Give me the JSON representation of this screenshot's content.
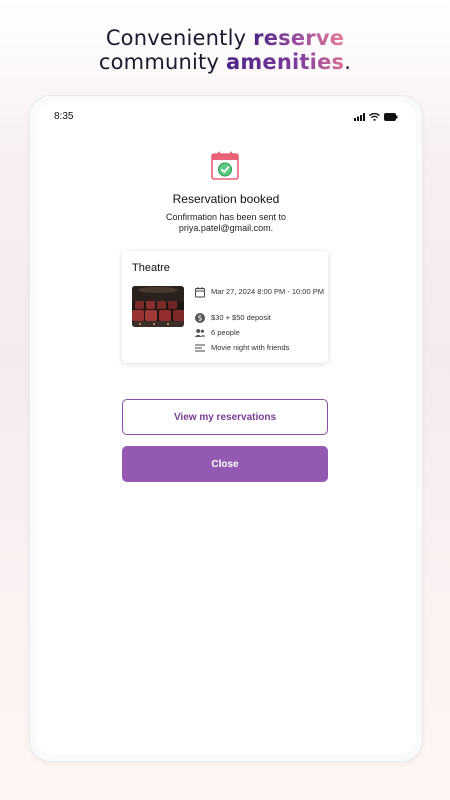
{
  "headline": {
    "line1_prefix": "Conveniently ",
    "line1_highlight": "reserve",
    "line2_prefix": "community ",
    "line2_highlight": "amenities",
    "line2_suffix": "."
  },
  "status_bar": {
    "time": "8:35"
  },
  "confirmation": {
    "title": "Reservation booked",
    "message_line1": "Confirmation has been sent to",
    "message_line2": "priya.patel@gmail.com."
  },
  "reservation": {
    "amenity": "Theatre",
    "datetime": "Mar 27, 2024 8:00 PM - 10:00 PM",
    "cost": "$30 + $50 deposit",
    "guests": "6 people",
    "note": "Movie night with friends"
  },
  "buttons": {
    "view_reservations": "View my reservations",
    "close": "Close"
  },
  "colors": {
    "accent": "#9359b3",
    "accent_dark": "#7a3c95",
    "calendar_red": "#e8637a",
    "check_green": "#3fb36b"
  }
}
